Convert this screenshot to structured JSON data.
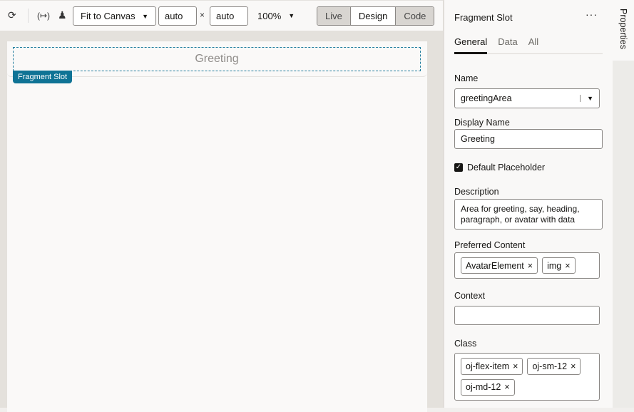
{
  "toolbar": {
    "fit_label": "Fit to Canvas",
    "width": "auto",
    "times": "×",
    "height": "auto",
    "zoom": "100%",
    "modes": [
      "Live",
      "Design",
      "Code"
    ]
  },
  "canvas": {
    "slot_placeholder": "Greeting",
    "slot_tag": "Fragment Slot"
  },
  "panel": {
    "title": "Fragment Slot",
    "more": "···",
    "tabs": [
      "General",
      "Data",
      "All"
    ],
    "name_label": "Name",
    "name_value": "greetingArea",
    "display_label": "Display Name",
    "display_value": "Greeting",
    "default_placeholder": "Default Placeholder",
    "default_checked": true,
    "desc_label": "Description",
    "desc_value": "Area for greeting, say, heading, paragraph, or avatar with data",
    "preferred_label": "Preferred Content",
    "preferred": [
      "AvatarElement",
      "img"
    ],
    "context_label": "Context",
    "context_value": "",
    "class_label": "Class",
    "classes": [
      "oj-flex-item",
      "oj-sm-12",
      "oj-md-12"
    ]
  },
  "side_tab": "Properties"
}
